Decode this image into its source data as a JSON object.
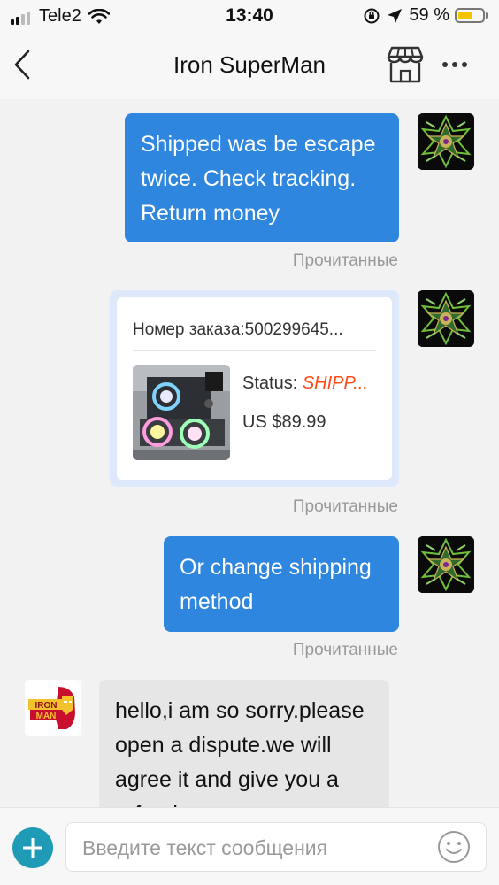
{
  "status_bar": {
    "carrier": "Tele2",
    "time": "13:40",
    "battery_percent": "59 %",
    "battery_level": 0.59,
    "icons": [
      "signal-icon",
      "wifi-icon",
      "orientation-lock-icon",
      "location-icon",
      "battery-icon"
    ]
  },
  "header": {
    "title": "Iron SuperMan",
    "icons": [
      "back-chevron-icon",
      "store-icon",
      "more-dots-icon"
    ]
  },
  "messages": {
    "m1": {
      "text": "Shipped was be escape twice. Check tracking. Return money",
      "read_label": "Прочитанные"
    },
    "order": {
      "number": "Номер заказа:500299645...",
      "status_label": "Status: ",
      "status_value": "SHIPP...",
      "price": "US $89.99",
      "read_label": "Прочитанные"
    },
    "m2": {
      "text": "Or change shipping method",
      "read_label": "Прочитанные"
    },
    "m3": {
      "text": "hello,i am so sorry.please open a dispute.we will agree it and give you a refund"
    }
  },
  "avatars": {
    "buyer": "ornate-green-emblem-avatar",
    "seller": "iron-man-logo-avatar",
    "seller_text": "IRON MAN"
  },
  "input_bar": {
    "placeholder": "Введите текст сообщения",
    "value": "",
    "icons": [
      "plus-icon",
      "emoji-icon"
    ]
  },
  "colors": {
    "outgoing_bubble": "#2e86de",
    "incoming_bubble": "#e6e6e6",
    "chat_background": "#f2f2f2",
    "order_status": "#ff4a1a",
    "plus_button": "#1f9bb5"
  }
}
